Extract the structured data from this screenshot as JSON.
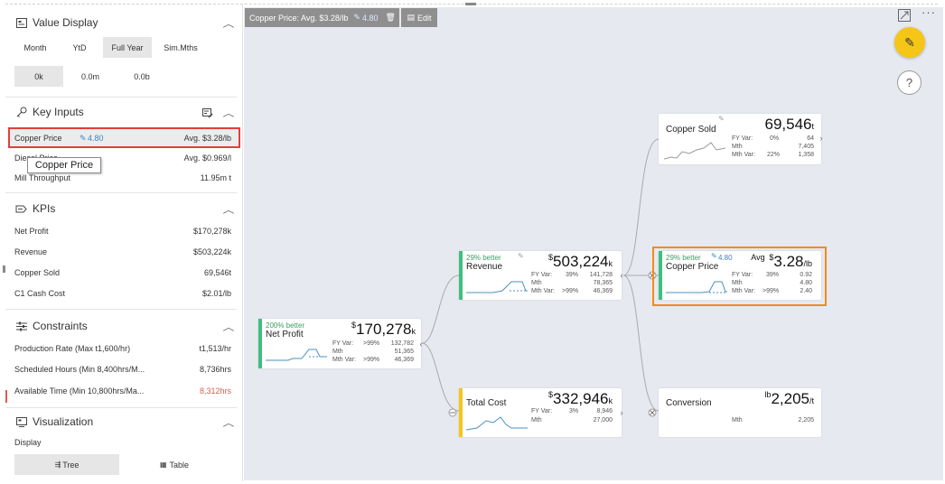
{
  "sidebar": {
    "value_display": {
      "title": "Value Display",
      "periods": [
        "Month",
        "YtD",
        "Full Year",
        "Sim.Mths"
      ],
      "selected_period": "Full Year",
      "scales": [
        "0k",
        "0.0m",
        "0.0b"
      ],
      "selected_scale": "0k"
    },
    "key_inputs": {
      "title": "Key Inputs",
      "items": [
        {
          "label": "Copper Price",
          "override": "4.80",
          "value": "Avg. $3.28/lb"
        },
        {
          "label": "Diesel Price",
          "value": "Avg. $0.969/l"
        },
        {
          "label": "Mill Throughput",
          "value": "11.95m t"
        }
      ],
      "tooltip": "Copper Price"
    },
    "kpis": {
      "title": "KPIs",
      "items": [
        {
          "label": "Net Profit",
          "value": "$170,278k"
        },
        {
          "label": "Revenue",
          "value": "$503,224k"
        },
        {
          "label": "Copper Sold",
          "value": "69,546t"
        },
        {
          "label": "C1 Cash Cost",
          "value": "$2.01/lb"
        }
      ]
    },
    "constraints": {
      "title": "Constraints",
      "items": [
        {
          "label": "Production Rate (Max t1,600/hr)",
          "value": "t1,513/hr"
        },
        {
          "label": "Scheduled Hours (Min 8,400hrs/M...",
          "value": "8,736hrs"
        },
        {
          "label": "Available Time (Min 10,800hrs/Ma...",
          "value": "8,312hrs",
          "status": "violation"
        }
      ]
    },
    "visualization": {
      "title": "Visualization",
      "display_label": "Display",
      "options": [
        "Tree",
        "Table"
      ],
      "selected": "Tree"
    }
  },
  "topbar": {
    "selection_label": "Copper Price: Avg. $3.28/lb",
    "override_value": "4.80",
    "edit_label": "Edit"
  },
  "tree": {
    "net_profit": {
      "better": "200% better",
      "name": "Net Profit",
      "prefix": "$",
      "value": "170,278",
      "unit": "k",
      "rows": [
        [
          "FY Var:",
          ">99%",
          "132,782"
        ],
        [
          "Mth",
          "",
          "51,365"
        ],
        [
          "Mth Var:",
          ">99%",
          "46,369"
        ]
      ]
    },
    "revenue": {
      "better": "29% better",
      "name": "Revenue",
      "prefix": "$",
      "value": "503,224",
      "unit": "k",
      "rows": [
        [
          "FY Var:",
          "39%",
          "141,728"
        ],
        [
          "Mth",
          "",
          "78,365"
        ],
        [
          "Mth Var:",
          ">99%",
          "46,369"
        ]
      ]
    },
    "total_cost": {
      "name": "Total Cost",
      "prefix": "$",
      "value": "332,946",
      "unit": "k",
      "rows": [
        [
          "FY Var:",
          "3%",
          "8,946"
        ],
        [
          "Mth",
          "",
          "27,000"
        ]
      ]
    },
    "copper_sold": {
      "name": "Copper Sold",
      "value": "69,546",
      "unit": "t",
      "rows": [
        [
          "FY Var:",
          "0%",
          "64"
        ],
        [
          "Mth",
          "",
          "7,405"
        ],
        [
          "Mth Var:",
          "22%",
          "1,358"
        ]
      ]
    },
    "copper_price": {
      "better": "29% better",
      "override": "4.80",
      "name": "Copper Price",
      "prefix_label": "Avg",
      "prefix": "$",
      "value": "3.28",
      "unit": "/lb",
      "rows": [
        [
          "FY Var:",
          "39%",
          "0.92"
        ],
        [
          "Mth",
          "",
          "4.80"
        ],
        [
          "Mth Var:",
          ">99%",
          "2.40"
        ]
      ]
    },
    "conversion": {
      "name": "Conversion",
      "prefix": "lb",
      "value": "2,205",
      "unit": "/t",
      "rows": [
        [
          "Mth",
          "",
          "2,205"
        ]
      ]
    }
  },
  "colors": {
    "positive": "#3fbf7f",
    "warning": "#f5c518",
    "selection": "#f48a1c",
    "error": "#e0403a",
    "canvas": "#e6e9f0"
  }
}
